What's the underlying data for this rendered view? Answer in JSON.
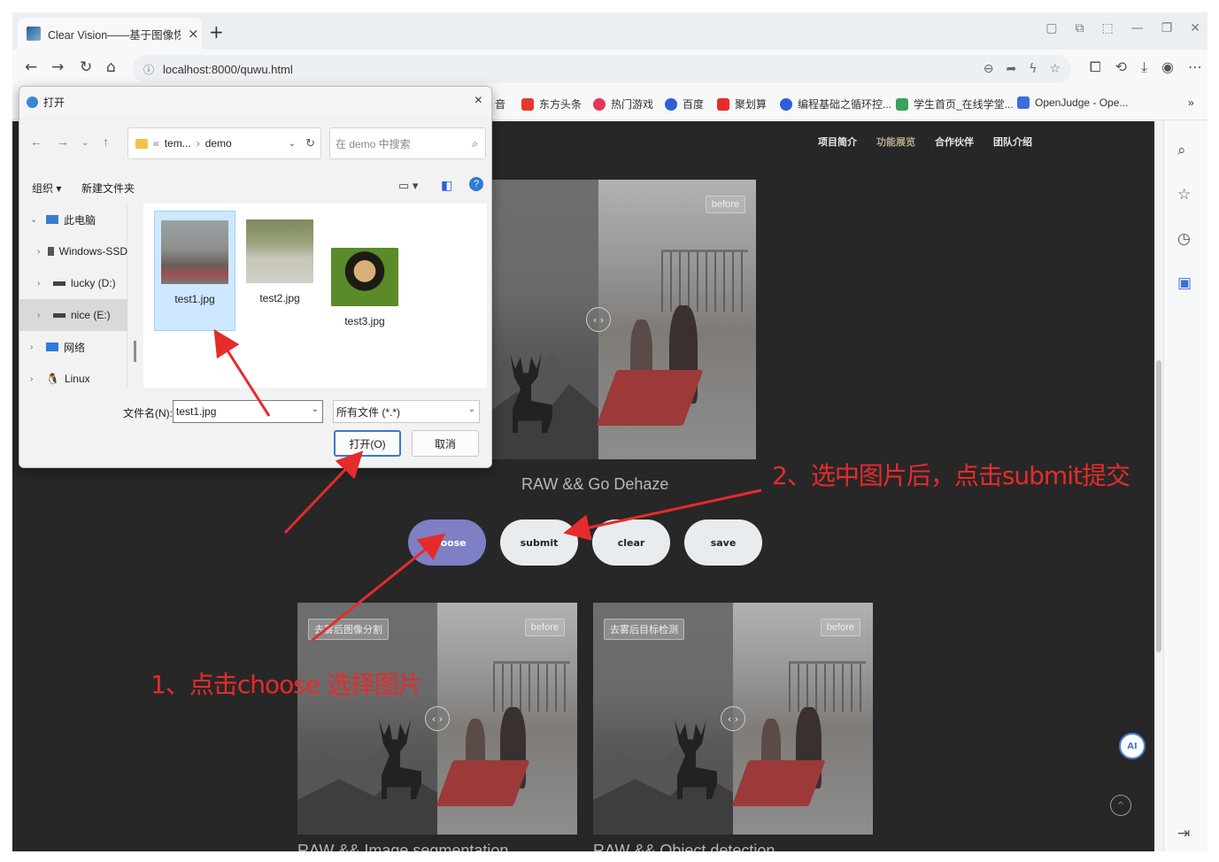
{
  "browser": {
    "tab_title": "Clear Vision——基于图像恢复的",
    "tab_close": "×",
    "new_tab": "+",
    "url": "localhost:8000/quwu.html",
    "nav": {
      "back": "←",
      "forward": "→",
      "reload": "↻",
      "home": "⌂"
    },
    "bookmarks": [
      {
        "label": "音",
        "color": "#333333"
      },
      {
        "label": "东方头条",
        "color": "#e23b2b"
      },
      {
        "label": "热门游戏",
        "color": "#e8345a"
      },
      {
        "label": "百度",
        "color": "#2f5fd8"
      },
      {
        "label": "聚划算",
        "color": "#e62b2b"
      },
      {
        "label": "编程基础之循环控...",
        "color": "#2f5fd8"
      },
      {
        "label": "学生首页_在线学堂...",
        "color": "#3aa05a"
      },
      {
        "label": "OpenJudge - Ope...",
        "color": "#3a6ed8"
      }
    ],
    "bookmarks_more": "»"
  },
  "page": {
    "menu": [
      "项目简介",
      "功能展览",
      "合作伙伴",
      "团队介绍"
    ],
    "compare_tag_before": "before",
    "compare_handle": "‹ ›",
    "captions": {
      "dehaze": "RAW && Go Dehaze",
      "segmentation": "RAW && Image segmentation",
      "detection": "RAW && Object detection"
    },
    "segmentation_tag": "去雾后图像分割",
    "detection_tag": "去雾后目标检测",
    "buttons": {
      "choose": "choose",
      "submit": "submit",
      "clear": "clear",
      "save": "save"
    },
    "ai_badge": "AI",
    "scroll_top": "^"
  },
  "dialog": {
    "title": "打开",
    "close": "×",
    "path": [
      "tem...",
      "demo"
    ],
    "path_sep": "«",
    "path_arrow": "›",
    "search_placeholder": "在 demo 中搜索",
    "toolbar": {
      "organize": "组织 ▾",
      "new_folder": "新建文件夹"
    },
    "tree": [
      {
        "label": "此电脑",
        "chevron": "⌄"
      },
      {
        "label": "Windows-SSD",
        "chevron": "›"
      },
      {
        "label": "lucky (D:)",
        "chevron": "›"
      },
      {
        "label": "nice (E:)",
        "chevron": "›"
      },
      {
        "label": "网络",
        "chevron": "›"
      },
      {
        "label": "Linux",
        "chevron": "›"
      }
    ],
    "files": [
      {
        "name": "test1.jpg"
      },
      {
        "name": "test2.jpg"
      },
      {
        "name": "test3.jpg"
      }
    ],
    "filename_label": "文件名(N):",
    "filename_value": "test1.jpg",
    "filetype": "所有文件 (*.*)",
    "open_button": "打开(O)",
    "cancel_button": "取消"
  },
  "annotations": {
    "step1": "1、点击choose  选择图片",
    "step2": "2、选中图片后，点击submit提交",
    "color": "#e62b2b"
  }
}
